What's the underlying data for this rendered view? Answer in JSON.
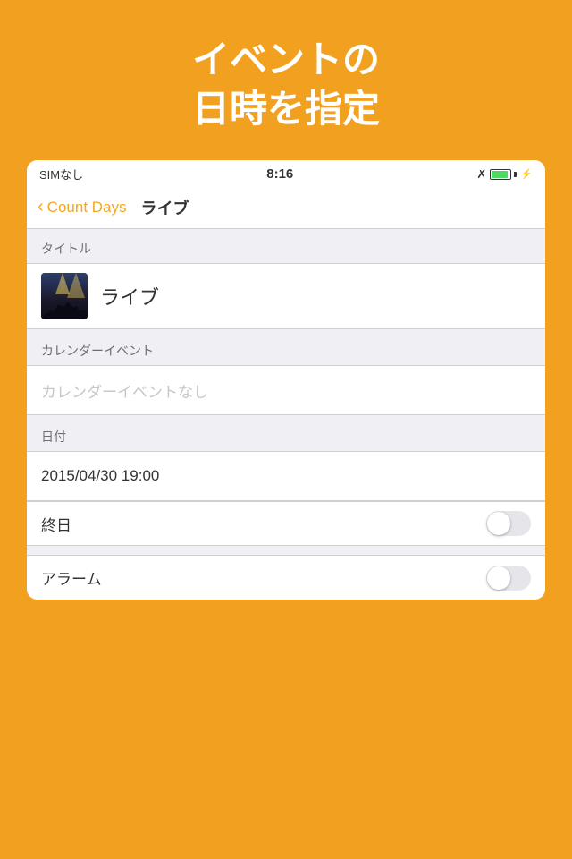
{
  "header": {
    "title_line1": "イベントの",
    "title_line2": "日時を指定"
  },
  "status_bar": {
    "carrier": "SIMなし",
    "time": "8:16",
    "bluetooth": "✦",
    "battery_level": "green",
    "charging": true
  },
  "nav": {
    "back_label": "Count Days",
    "page_title": "ライブ"
  },
  "sections": {
    "title_section": {
      "header": "タイトル",
      "event_name": "ライブ"
    },
    "calendar_section": {
      "header": "カレンダーイベント",
      "placeholder": "カレンダーイベントなし"
    },
    "date_section": {
      "header": "日付",
      "date_value": "2015/04/30 19:00"
    },
    "allday_section": {
      "label": "終日"
    },
    "alarm_section": {
      "label": "アラーム"
    }
  }
}
